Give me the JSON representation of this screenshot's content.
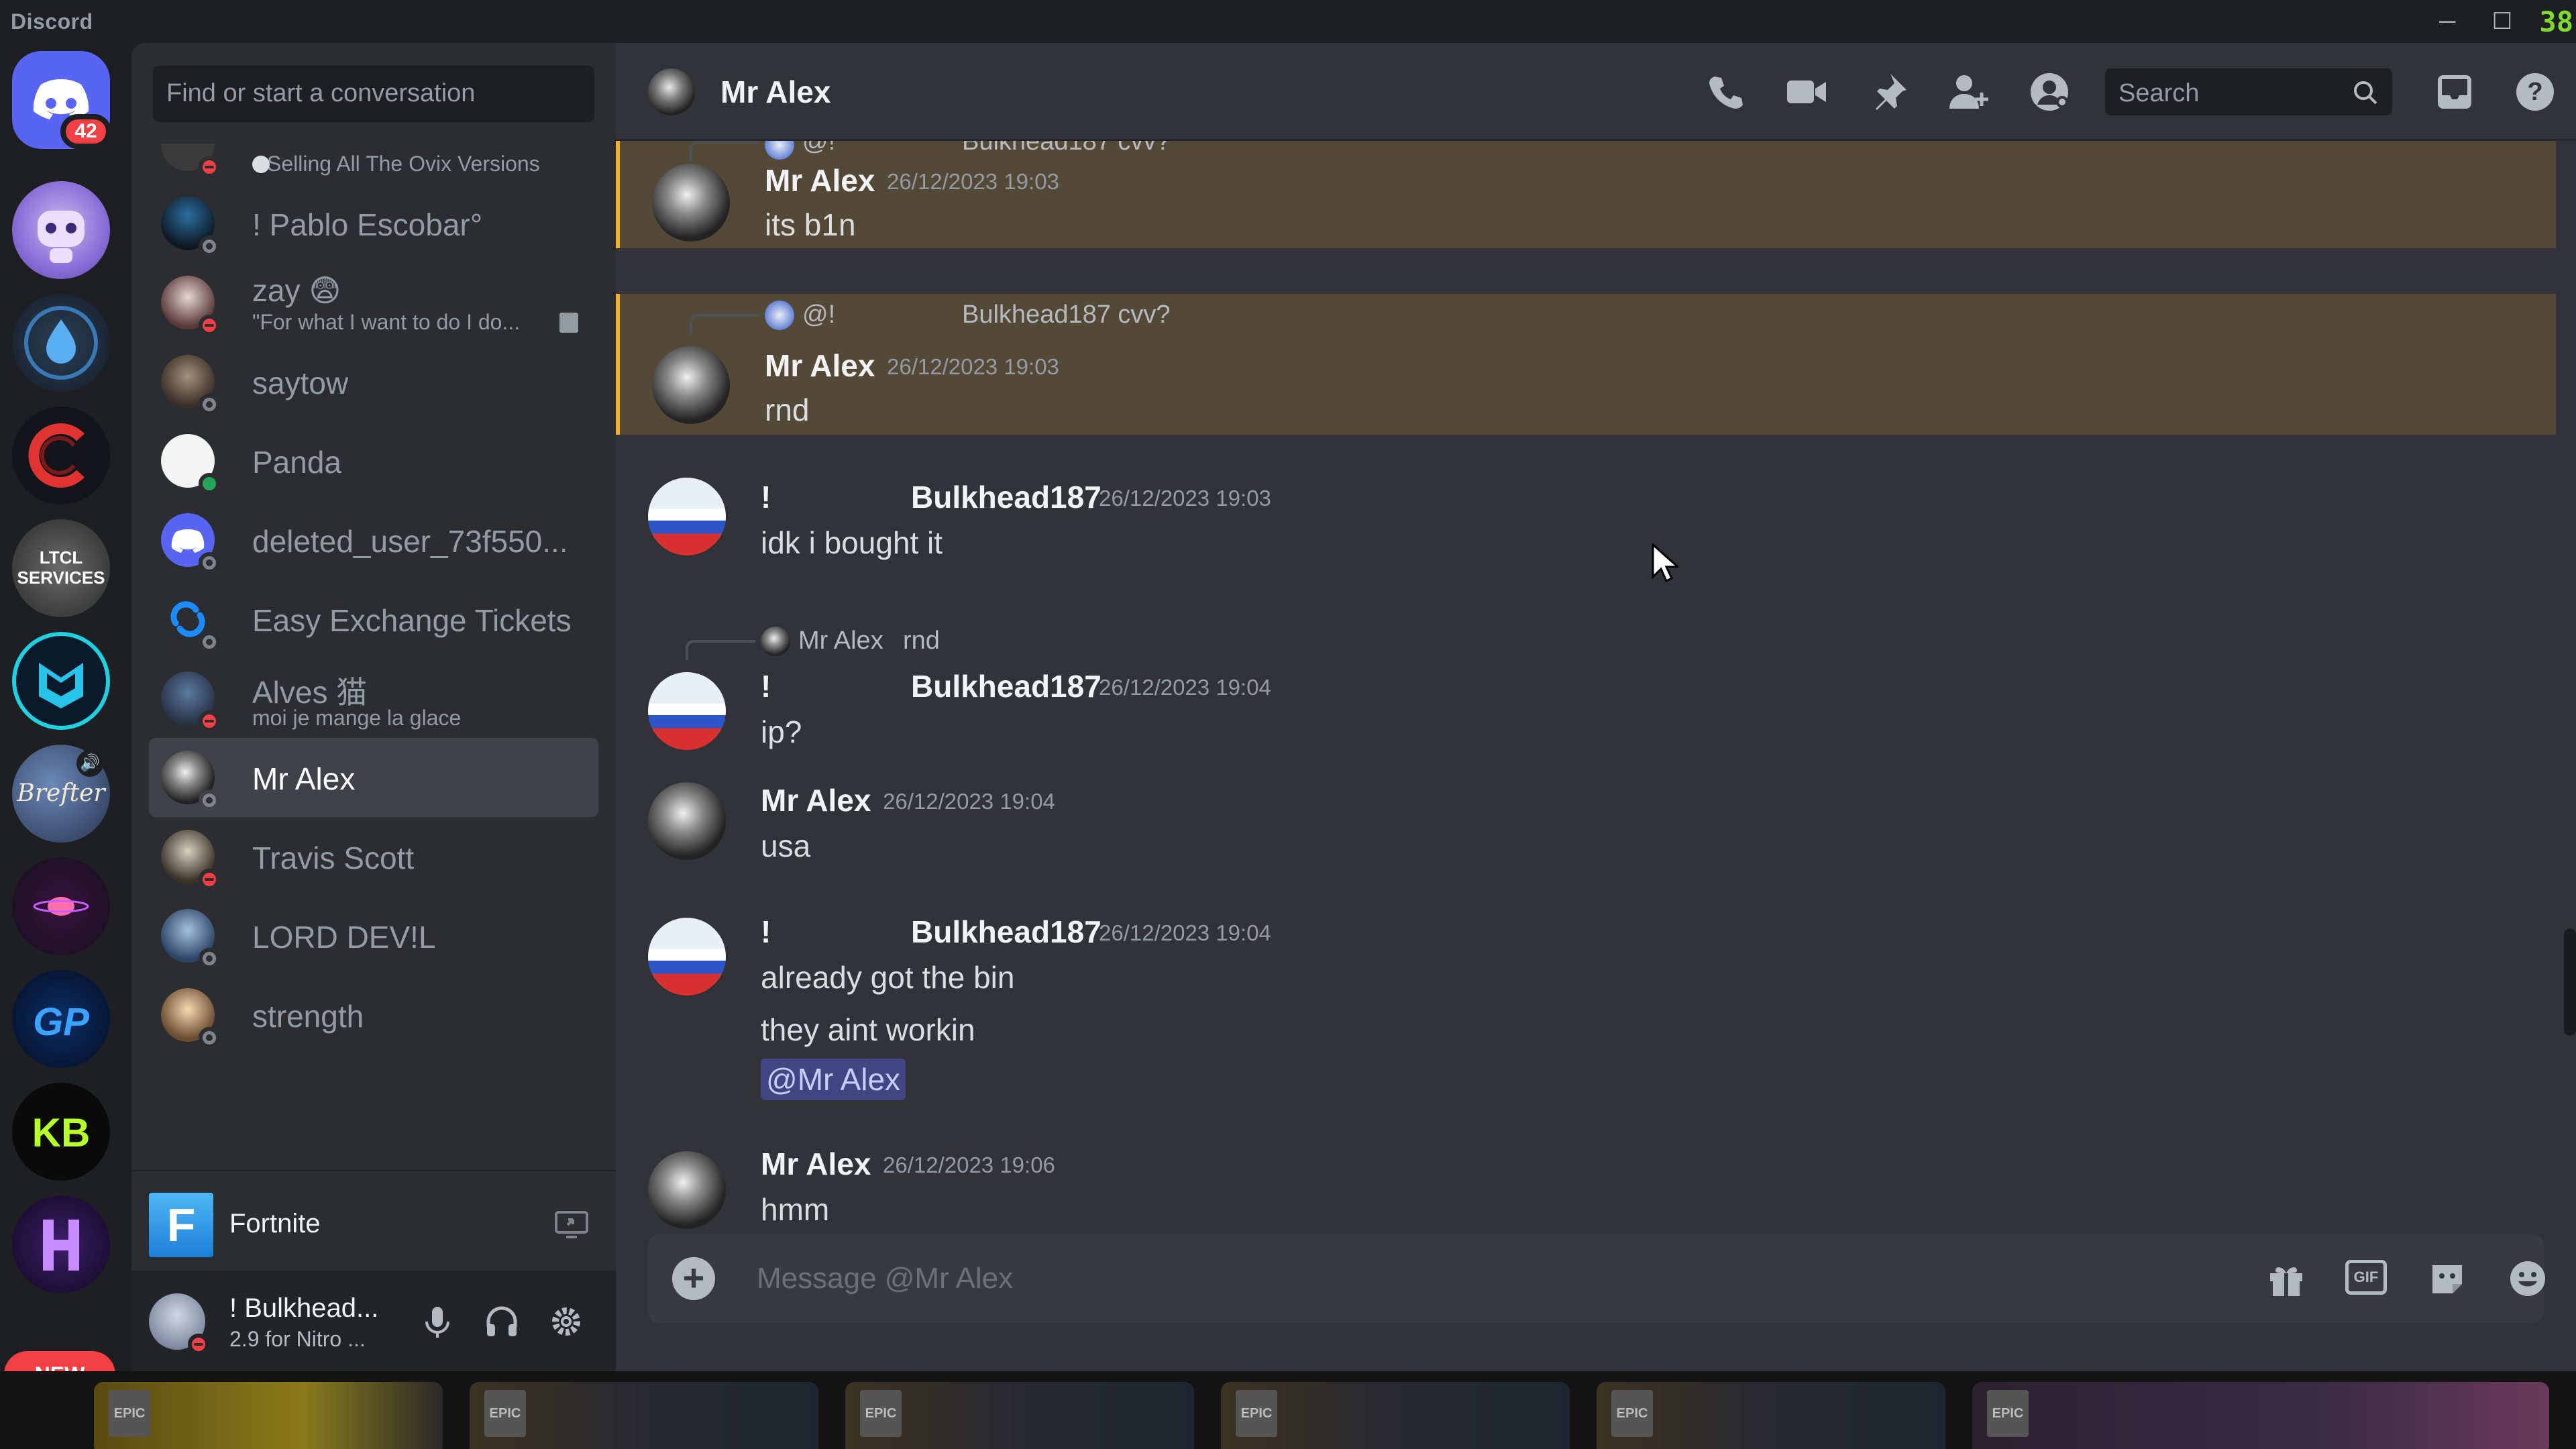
{
  "app": {
    "title": "Discord",
    "fps": "38"
  },
  "servers": {
    "home_badge": "42",
    "ltcl_label": "LTCL SERVICES",
    "brefer_label": "Brefter",
    "kb_label": "KB",
    "new_badge": "NEW"
  },
  "dm_sidebar": {
    "search_placeholder": "Find or start a conversation",
    "items": [
      {
        "name": "",
        "sub": "Selling All The Ovix Versions",
        "status": "dnd"
      },
      {
        "name": "! Pablo Escobar°",
        "sub": "",
        "status": "off"
      },
      {
        "name": "zay 😨",
        "sub": "\"For what I want to do I do...",
        "status": "dnd"
      },
      {
        "name": "saytow",
        "sub": "",
        "status": "off"
      },
      {
        "name": "Panda",
        "sub": "",
        "status": "on"
      },
      {
        "name": "deleted_user_73f550...",
        "sub": "",
        "status": "off"
      },
      {
        "name": "Easy Exchange Tickets",
        "sub": "",
        "status": "off"
      },
      {
        "name": "Alves 猫",
        "sub": "moi je mange la glace",
        "status": "dnd"
      },
      {
        "name": "Mr Alex",
        "sub": "",
        "status": "off"
      },
      {
        "name": "Travis Scott",
        "sub": "",
        "status": "dnd"
      },
      {
        "name": "LORD DEV!L",
        "sub": "",
        "status": "off"
      },
      {
        "name": "strength",
        "sub": "",
        "status": "off"
      }
    ],
    "game": {
      "icon_letter": "F",
      "name": "Fortnite"
    },
    "user": {
      "name": "! Bulkhead...",
      "status": "2.9 for Nitro ..."
    }
  },
  "chat": {
    "header": {
      "name": "Mr Alex",
      "search_placeholder": "Search"
    },
    "messages": [
      {
        "reply_author": "@!",
        "reply_text": "Bulkhead187 cvv?",
        "author": "Mr Alex",
        "time": "26/12/2023 19:03",
        "text": "its b1n"
      },
      {
        "reply_author": "@!",
        "reply_text": "Bulkhead187 cvv?",
        "author": "Mr Alex",
        "time": "26/12/2023 19:03",
        "text": "rnd"
      },
      {
        "prefix": "!",
        "author": "Bulkhead187",
        "time": "26/12/2023 19:03",
        "text": "idk i bought it"
      },
      {
        "reply_author": "Mr Alex",
        "reply_text": "rnd",
        "prefix": "!",
        "author": "Bulkhead187",
        "time": "26/12/2023 19:04",
        "text": "ip?"
      },
      {
        "author": "Mr Alex",
        "time": "26/12/2023 19:04",
        "text": "usa"
      },
      {
        "prefix": "!",
        "author": "Bulkhead187",
        "time": "26/12/2023 19:04",
        "lines": [
          "already got the bin",
          "they aint workin"
        ],
        "mention": "@Mr Alex"
      },
      {
        "author": "Mr Alex",
        "time": "26/12/2023 19:06",
        "text": "hmm"
      }
    ],
    "composer": {
      "placeholder": "Message @Mr Alex",
      "gif_label": "GIF"
    }
  },
  "taskbar": {
    "tile_label": "EPIC GAMES"
  },
  "colors": {
    "accent": "#5865f2",
    "dnd": "#f23f43",
    "online": "#23a55a",
    "mention_bg": "#f0b132"
  }
}
